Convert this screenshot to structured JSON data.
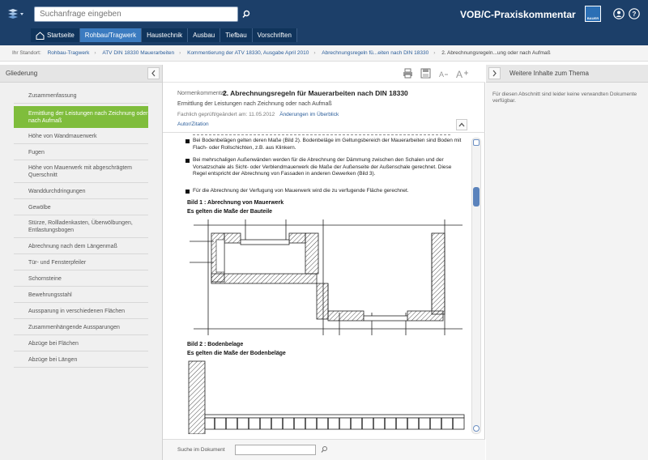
{
  "header": {
    "search_placeholder": "Suchanfrage eingeben",
    "brand": "VOB/C-Praxiskommentar",
    "logo_text": "BAUER",
    "nav": [
      "Startseite",
      "Rohbau/Tragwerk",
      "Haustechnik",
      "Ausbau",
      "Tiefbau",
      "Vorschriften"
    ],
    "nav_active": "Rohbau/Tragwerk"
  },
  "breadcrumb": {
    "label": "Ihr Standort:",
    "items": [
      "Rohbau-Tragwerk",
      "ATV DIN 18330 Mauerarbeiten",
      "Kommentierung der ATV 18330, Ausgabe April 2010",
      "Abrechnungsregeln fü...eiten nach DIN 18330"
    ],
    "current": "2. Abrechnungsregeln...ung oder nach Aufmaß"
  },
  "left_panel": {
    "title": "Gliederung",
    "items": [
      "Zusammenfassung",
      "Ermittlung der Leistungen nach Zeichnung oder nach Aufmaß",
      "Höhe von Wandmauerwerk",
      "Fugen",
      "Höhe von Mauerwerk mit abgeschrägtem Querschnitt",
      "Wanddurchdringungen",
      "Gewölbe",
      "Stürze, Rollladenkasten, Überwölbungen, Entlastungsbogen",
      "Abrechnung nach dem Längenmaß",
      "Tür- und Fensterpfeiler",
      "Schornsteine",
      "Bewehrungsstahl",
      "Aussparung in verschiedenen Flächen",
      "Zusammenhängende Aussparungen",
      "Abzüge bei Flächen",
      "Abzüge bei Längen"
    ],
    "active_index": 1
  },
  "main": {
    "title_label": "Normenkommentar:",
    "title": "2. Abrechnungsregeln für Mauerarbeiten nach DIN 18330",
    "subtitle": "Ermittlung der Leistungen nach Zeichnung oder nach Aufmaß",
    "meta": "Fachlich geprüft/geändert am: 11.05.2012",
    "changes_link": "Änderungen im Überblick",
    "author_link": "Autor/Zitation",
    "bullets": [
      "Bei Bodenbelägen gelten deren Maße (Bild 2). Bodenbeläge im Geltungsbereich der Mauerarbeiten sind Boden mit Flach- oder Rollschichten, z.B. aus Klinkern.",
      "Bei mehrschaligen Außenwänden werden für die Abrechnung der Dämmung zwischen den Schalen und der Vorsatzschale als Sicht- oder Verblendmauerwerk die Maße der Außenseite der Außenschale gerechnet. Diese Regel entspricht der Abrechnung von Fassaden in anderen Gewerken (Bild 3).",
      "Für die Abrechnung der Verfugung von Mauerwerk wird die zu verfugende Fläche gerechnet."
    ],
    "figure1_title": "Bild 1 : Abrechnung von Mauerwerk",
    "figure1_sub": "Es gelten die Maße der Bauteile",
    "figure2_title": "Bild 2 : Bodenbelage",
    "figure2_sub": "Es gelten die Maße der Bodenbeläge",
    "footer_search_label": "Suche im Dokument"
  },
  "right_panel": {
    "title": "Weitere Inhalte zum Thema",
    "text": "Für diesen Abschnitt sind leider keine verwandten Dokumente verfügbar."
  }
}
